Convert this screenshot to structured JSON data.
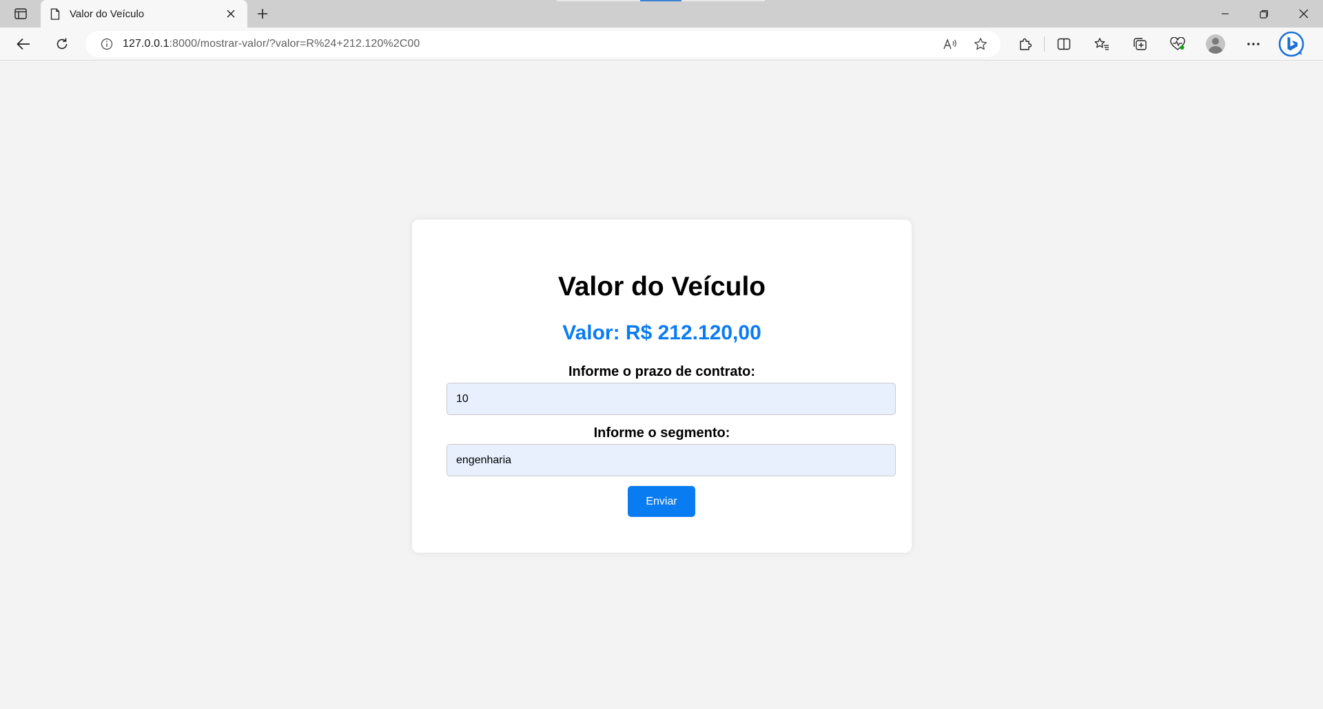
{
  "browser": {
    "tab": {
      "title": "Valor do Veículo"
    },
    "address": {
      "host": "127.0.0.1",
      "path": ":8000/mostrar-valor/?valor=R%24+212.120%2C00"
    },
    "icons": {
      "tab_actions": "tab-actions-icon",
      "page": "page-icon",
      "close_tab": "close-icon",
      "new_tab": "plus-icon",
      "back": "back-arrow-icon",
      "refresh": "refresh-icon",
      "info": "info-icon",
      "read_aloud": "read-aloud-icon",
      "favorite": "star-icon",
      "extensions": "puzzle-icon",
      "split_screen": "split-screen-icon",
      "favorites": "favorites-icon",
      "collections": "collections-icon",
      "browser_essentials": "heart-pulse-icon",
      "profile": "profile-icon",
      "more": "more-icon",
      "copilot": "bing-icon",
      "minimize": "minimize-icon",
      "restore": "restore-icon",
      "close_window": "close-icon"
    }
  },
  "page": {
    "heading": "Valor do Veículo",
    "valor": "Valor: R$ 212.120,00",
    "prazo": {
      "label": "Informe o prazo de contrato:",
      "value": "10"
    },
    "segmento": {
      "label": "Informe o segmento:",
      "value": "engenharia"
    },
    "submit_label": "Enviar"
  },
  "colors": {
    "accent": "#0a7cf2",
    "input_background": "#e8f0fe",
    "page_background": "#f3f3f3",
    "card_background": "#ffffff"
  }
}
